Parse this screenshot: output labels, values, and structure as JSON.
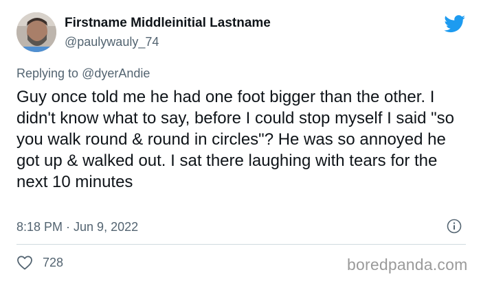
{
  "tweet": {
    "author_name": "Firstname Middleinitial Lastname",
    "author_handle": "@paulywauly_74",
    "replying_prefix": "Replying to ",
    "replying_to": "@dyerAndie",
    "text": "Guy once told me he had one foot bigger than the other. I didn't know what to say, before I could stop myself I said \"so you walk round & round in circles\"? He was so annoyed he got up & walked out. I sat there laughing with tears for the next 10 minutes",
    "timestamp": "8:18 PM · Jun 9, 2022",
    "likes": "728"
  },
  "icons": {
    "brand": "twitter-bird-icon",
    "info": "info-icon",
    "like": "heart-icon",
    "accent_color": "#1d9bf0"
  },
  "watermark": "boredpanda.com"
}
